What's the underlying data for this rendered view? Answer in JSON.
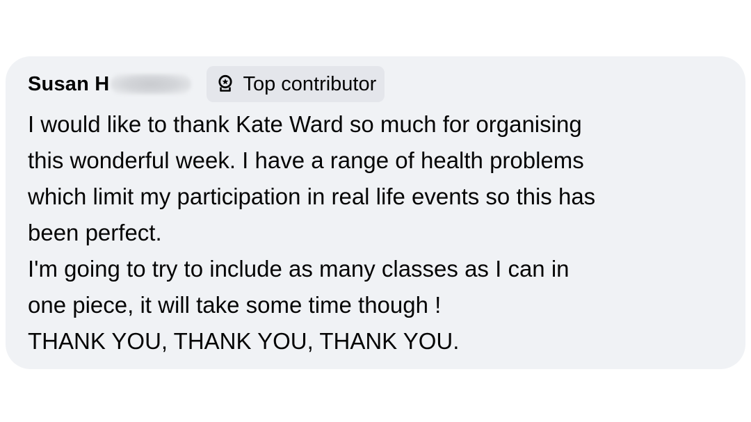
{
  "comment": {
    "author": "Susan H",
    "badge": {
      "label": "Top contributor",
      "icon": "badge-award-icon"
    },
    "text_lines": [
      "I would like to thank Kate Ward so much for organising",
      "this wonderful week. I have a range of health problems",
      "which limit my participation in real life events so this has",
      "been perfect.",
      "I'm going to try to include as many classes as I can in",
      "one piece, it will take some time though !",
      "THANK YOU, THANK YOU, THANK YOU."
    ]
  },
  "colors": {
    "bubble_background": "#f0f2f5",
    "badge_background": "#e4e6eb",
    "text": "#050505"
  }
}
